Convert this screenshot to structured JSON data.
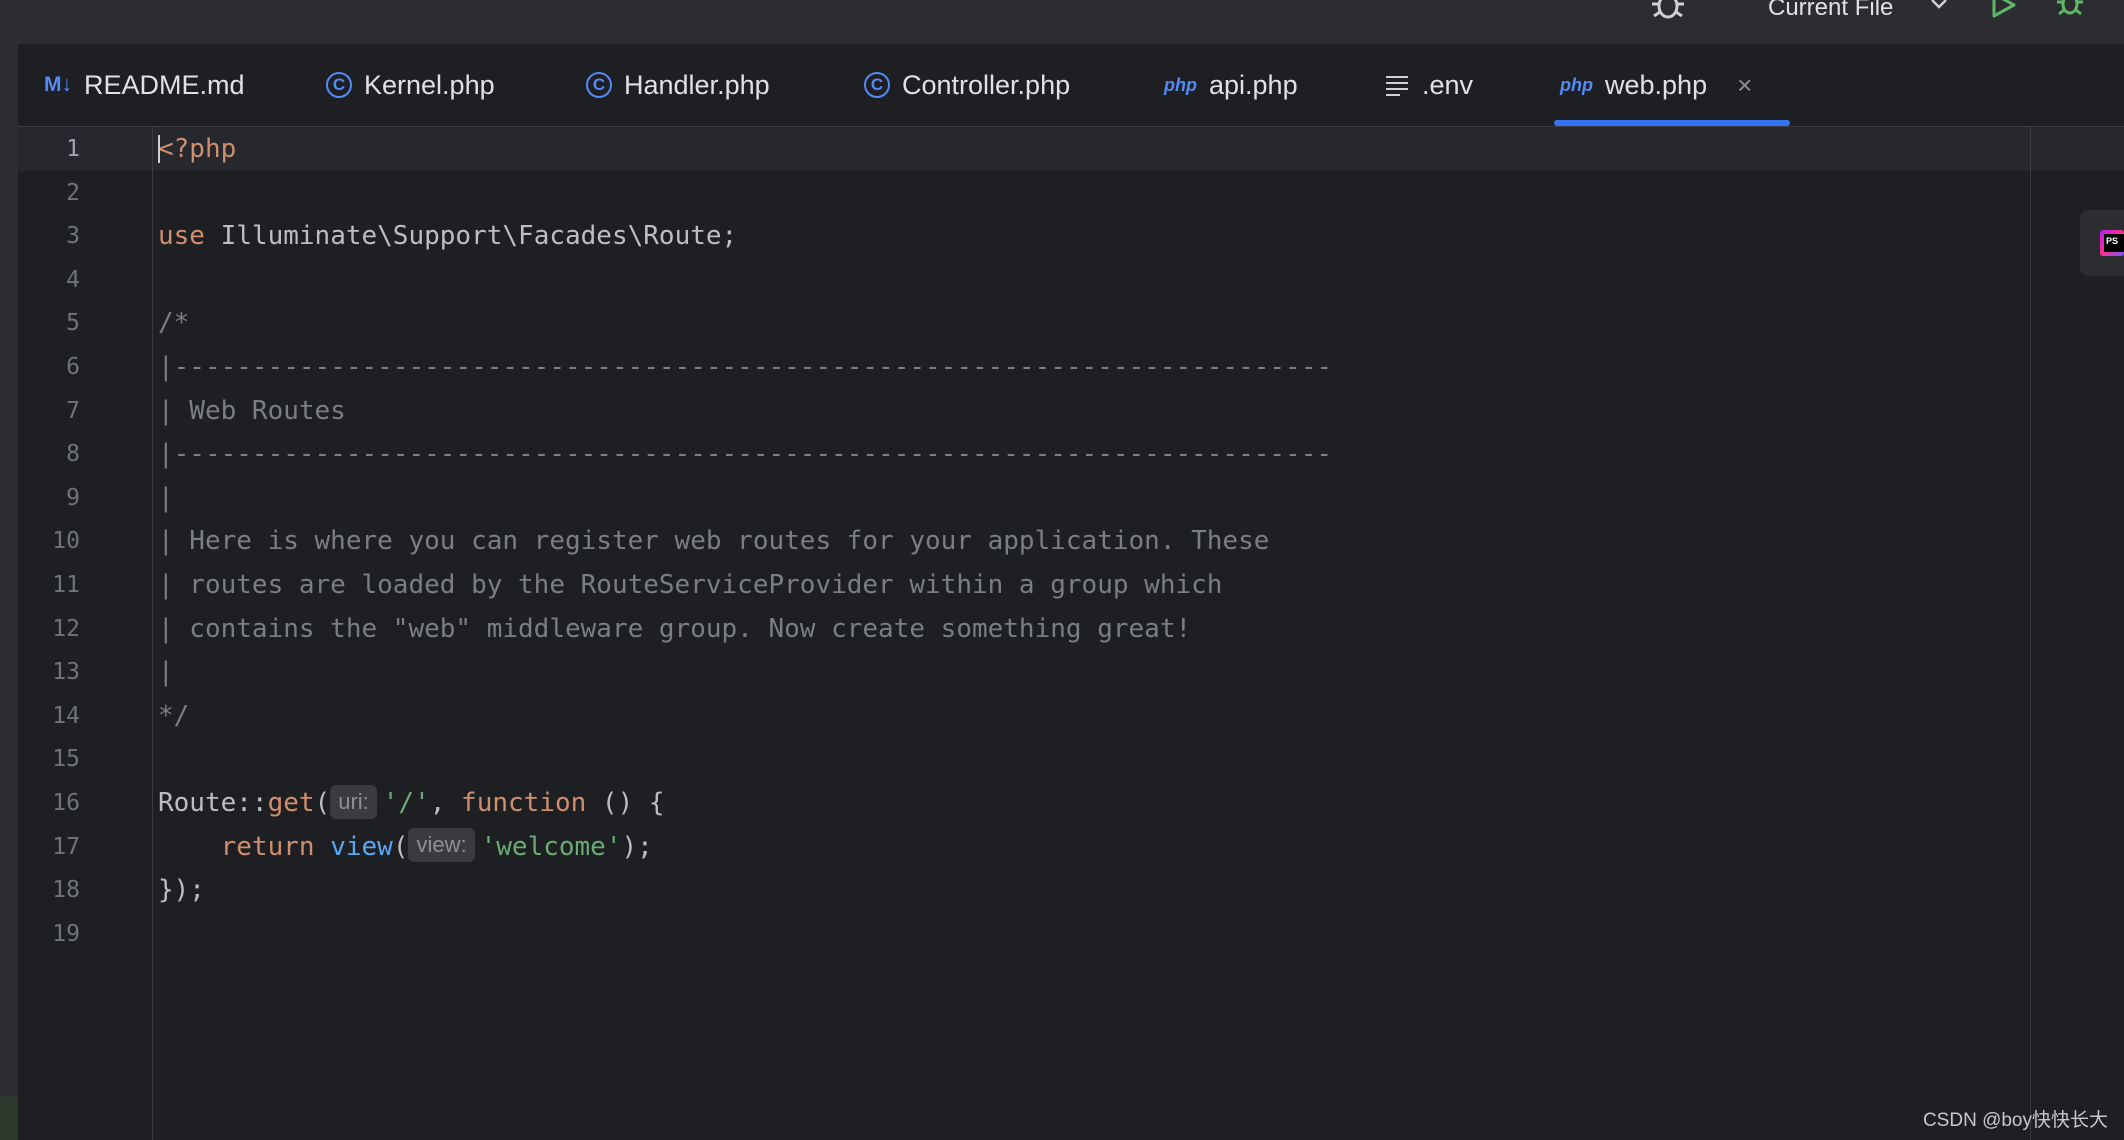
{
  "toolbar": {
    "run_config": "Current File"
  },
  "tabs": [
    {
      "label": "README.md",
      "icon": "markdown-icon",
      "icon_text": "M↓",
      "active": false
    },
    {
      "label": "Kernel.php",
      "icon": "class-icon",
      "icon_text": "C",
      "active": false
    },
    {
      "label": "Handler.php",
      "icon": "class-icon",
      "icon_text": "C",
      "active": false
    },
    {
      "label": "Controller.php",
      "icon": "class-icon",
      "icon_text": "C",
      "active": false
    },
    {
      "label": "api.php",
      "icon": "php-icon",
      "icon_text": "php",
      "active": false
    },
    {
      "label": ".env",
      "icon": "text-file-icon",
      "icon_text": "≡",
      "active": false
    },
    {
      "label": "web.php",
      "icon": "php-icon",
      "icon_text": "php",
      "active": true
    }
  ],
  "tab_close": "×",
  "editor": {
    "current_line": 1,
    "lines": [
      {
        "n": "1",
        "tokens": [
          {
            "t": "<?php",
            "c": "phptag"
          }
        ]
      },
      {
        "n": "2",
        "tokens": []
      },
      {
        "n": "3",
        "tokens": [
          {
            "t": "use",
            "c": "kw"
          },
          {
            "t": " Illuminate\\Support\\Facades\\Route;",
            "c": ""
          }
        ]
      },
      {
        "n": "4",
        "tokens": []
      },
      {
        "n": "5",
        "tokens": [
          {
            "t": "/*",
            "c": "cm"
          }
        ]
      },
      {
        "n": "6",
        "tokens": [
          {
            "t": "|--------------------------------------------------------------------------",
            "c": "cm"
          }
        ]
      },
      {
        "n": "7",
        "tokens": [
          {
            "t": "| Web Routes",
            "c": "cm"
          }
        ]
      },
      {
        "n": "8",
        "tokens": [
          {
            "t": "|--------------------------------------------------------------------------",
            "c": "cm"
          }
        ]
      },
      {
        "n": "9",
        "tokens": [
          {
            "t": "|",
            "c": "cm"
          }
        ]
      },
      {
        "n": "10",
        "tokens": [
          {
            "t": "| Here is where you can register web routes for your application. These",
            "c": "cm"
          }
        ]
      },
      {
        "n": "11",
        "tokens": [
          {
            "t": "| routes are loaded by the RouteServiceProvider within a group which",
            "c": "cm"
          }
        ]
      },
      {
        "n": "12",
        "tokens": [
          {
            "t": "| contains the \"web\" middleware group. Now create something great!",
            "c": "cm"
          }
        ]
      },
      {
        "n": "13",
        "tokens": [
          {
            "t": "|",
            "c": "cm"
          }
        ]
      },
      {
        "n": "14",
        "tokens": [
          {
            "t": "*/",
            "c": "cm"
          }
        ]
      },
      {
        "n": "15",
        "tokens": []
      },
      {
        "n": "16",
        "tokens": [
          {
            "t": "Route::",
            "c": ""
          },
          {
            "t": "get",
            "c": "kw"
          },
          {
            "t": "(",
            "c": ""
          },
          {
            "t": "uri:",
            "c": "hint"
          },
          {
            "t": "'/'",
            "c": "str"
          },
          {
            "t": ", ",
            "c": ""
          },
          {
            "t": "function",
            "c": "kw"
          },
          {
            "t": " () {",
            "c": ""
          }
        ]
      },
      {
        "n": "17",
        "tokens": [
          {
            "t": "    ",
            "c": ""
          },
          {
            "t": "return",
            "c": "kw"
          },
          {
            "t": " ",
            "c": ""
          },
          {
            "t": "view",
            "c": "fn"
          },
          {
            "t": "(",
            "c": ""
          },
          {
            "t": "view:",
            "c": "hint"
          },
          {
            "t": "'welcome'",
            "c": "str"
          },
          {
            "t": ");",
            "c": ""
          }
        ]
      },
      {
        "n": "18",
        "tokens": [
          {
            "t": "});",
            "c": ""
          }
        ]
      },
      {
        "n": "19",
        "tokens": []
      }
    ]
  },
  "watermark": "CSDN @boy快快长大",
  "colors": {
    "background": "#1e1f22",
    "keyword": "#cf8e6d",
    "comment": "#7a7e85",
    "string": "#6aab73",
    "function": "#56a8f5",
    "accent": "#3574f0"
  }
}
